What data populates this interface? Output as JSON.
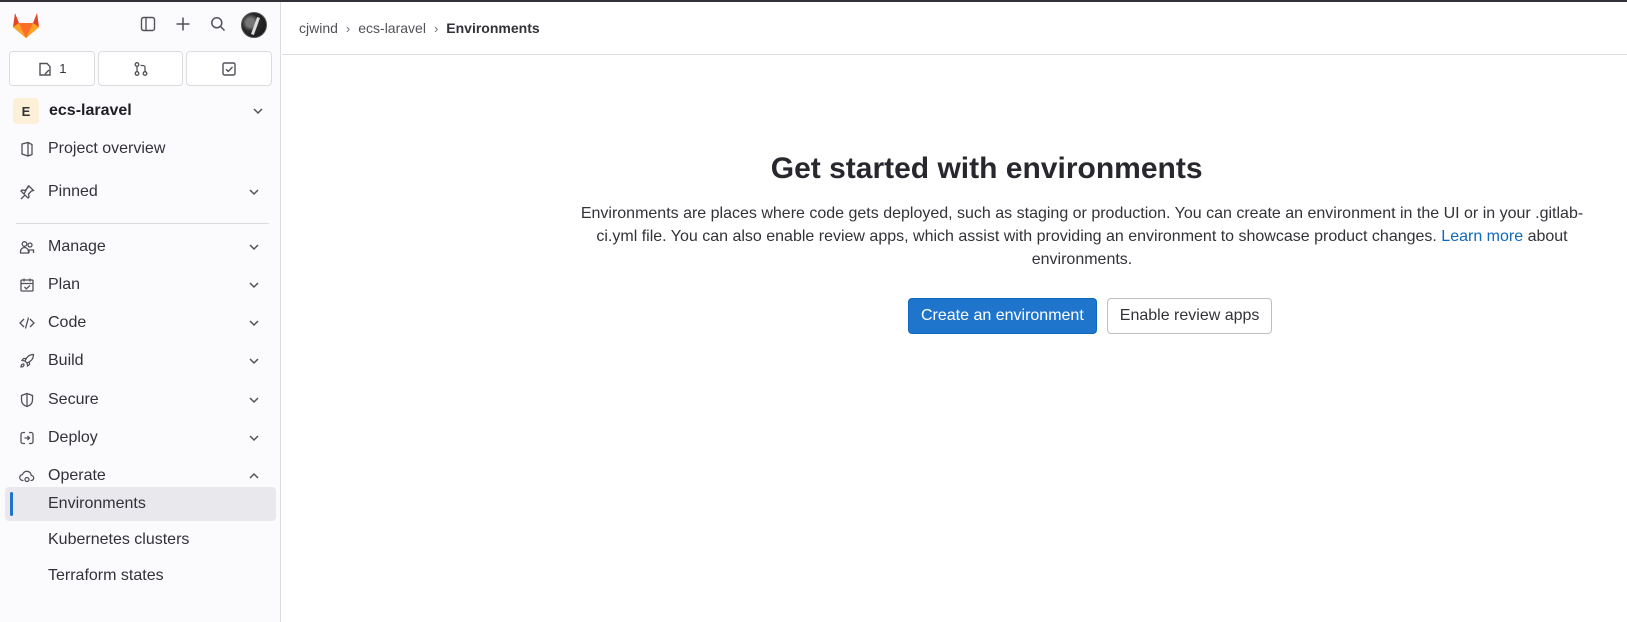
{
  "header": {
    "counters": [
      {
        "icon": "issue-icon",
        "count": "1"
      },
      {
        "icon": "merge-request-icon",
        "count": ""
      },
      {
        "icon": "todo-icon",
        "count": ""
      }
    ]
  },
  "project": {
    "initial": "E",
    "name": "ecs-laravel"
  },
  "sidebar": {
    "items": [
      {
        "label": "Project overview",
        "icon": "project-icon"
      },
      {
        "label": "Pinned",
        "icon": "pin-icon"
      },
      {
        "label": "Manage",
        "icon": "users-icon"
      },
      {
        "label": "Plan",
        "icon": "calendar-icon"
      },
      {
        "label": "Code",
        "icon": "code-icon"
      },
      {
        "label": "Build",
        "icon": "rocket-icon"
      },
      {
        "label": "Secure",
        "icon": "shield-icon"
      },
      {
        "label": "Deploy",
        "icon": "deploy-icon"
      },
      {
        "label": "Operate",
        "icon": "cloud-gear-icon"
      }
    ],
    "subitems": [
      {
        "label": "Environments",
        "active": true
      },
      {
        "label": "Kubernetes clusters",
        "active": false
      },
      {
        "label": "Terraform states",
        "active": false
      }
    ]
  },
  "breadcrumb": [
    "cjwind",
    "ecs-laravel",
    "Environments"
  ],
  "empty_state": {
    "title": "Get started with environments",
    "description_before": "Environments are places where code gets deployed, such as staging or production. You can create an environment in the UI or in your .gitlab-ci.yml file. You can also enable review apps, which assist with providing an environment to showcase product changes. ",
    "link": "Learn more",
    "description_after": " about environments.",
    "primary_button": "Create an environment",
    "secondary_button": "Enable review apps"
  },
  "colors": {
    "accent": "#1f75cb",
    "link": "#1068bf",
    "sidebar_bg": "#fbfafd"
  }
}
